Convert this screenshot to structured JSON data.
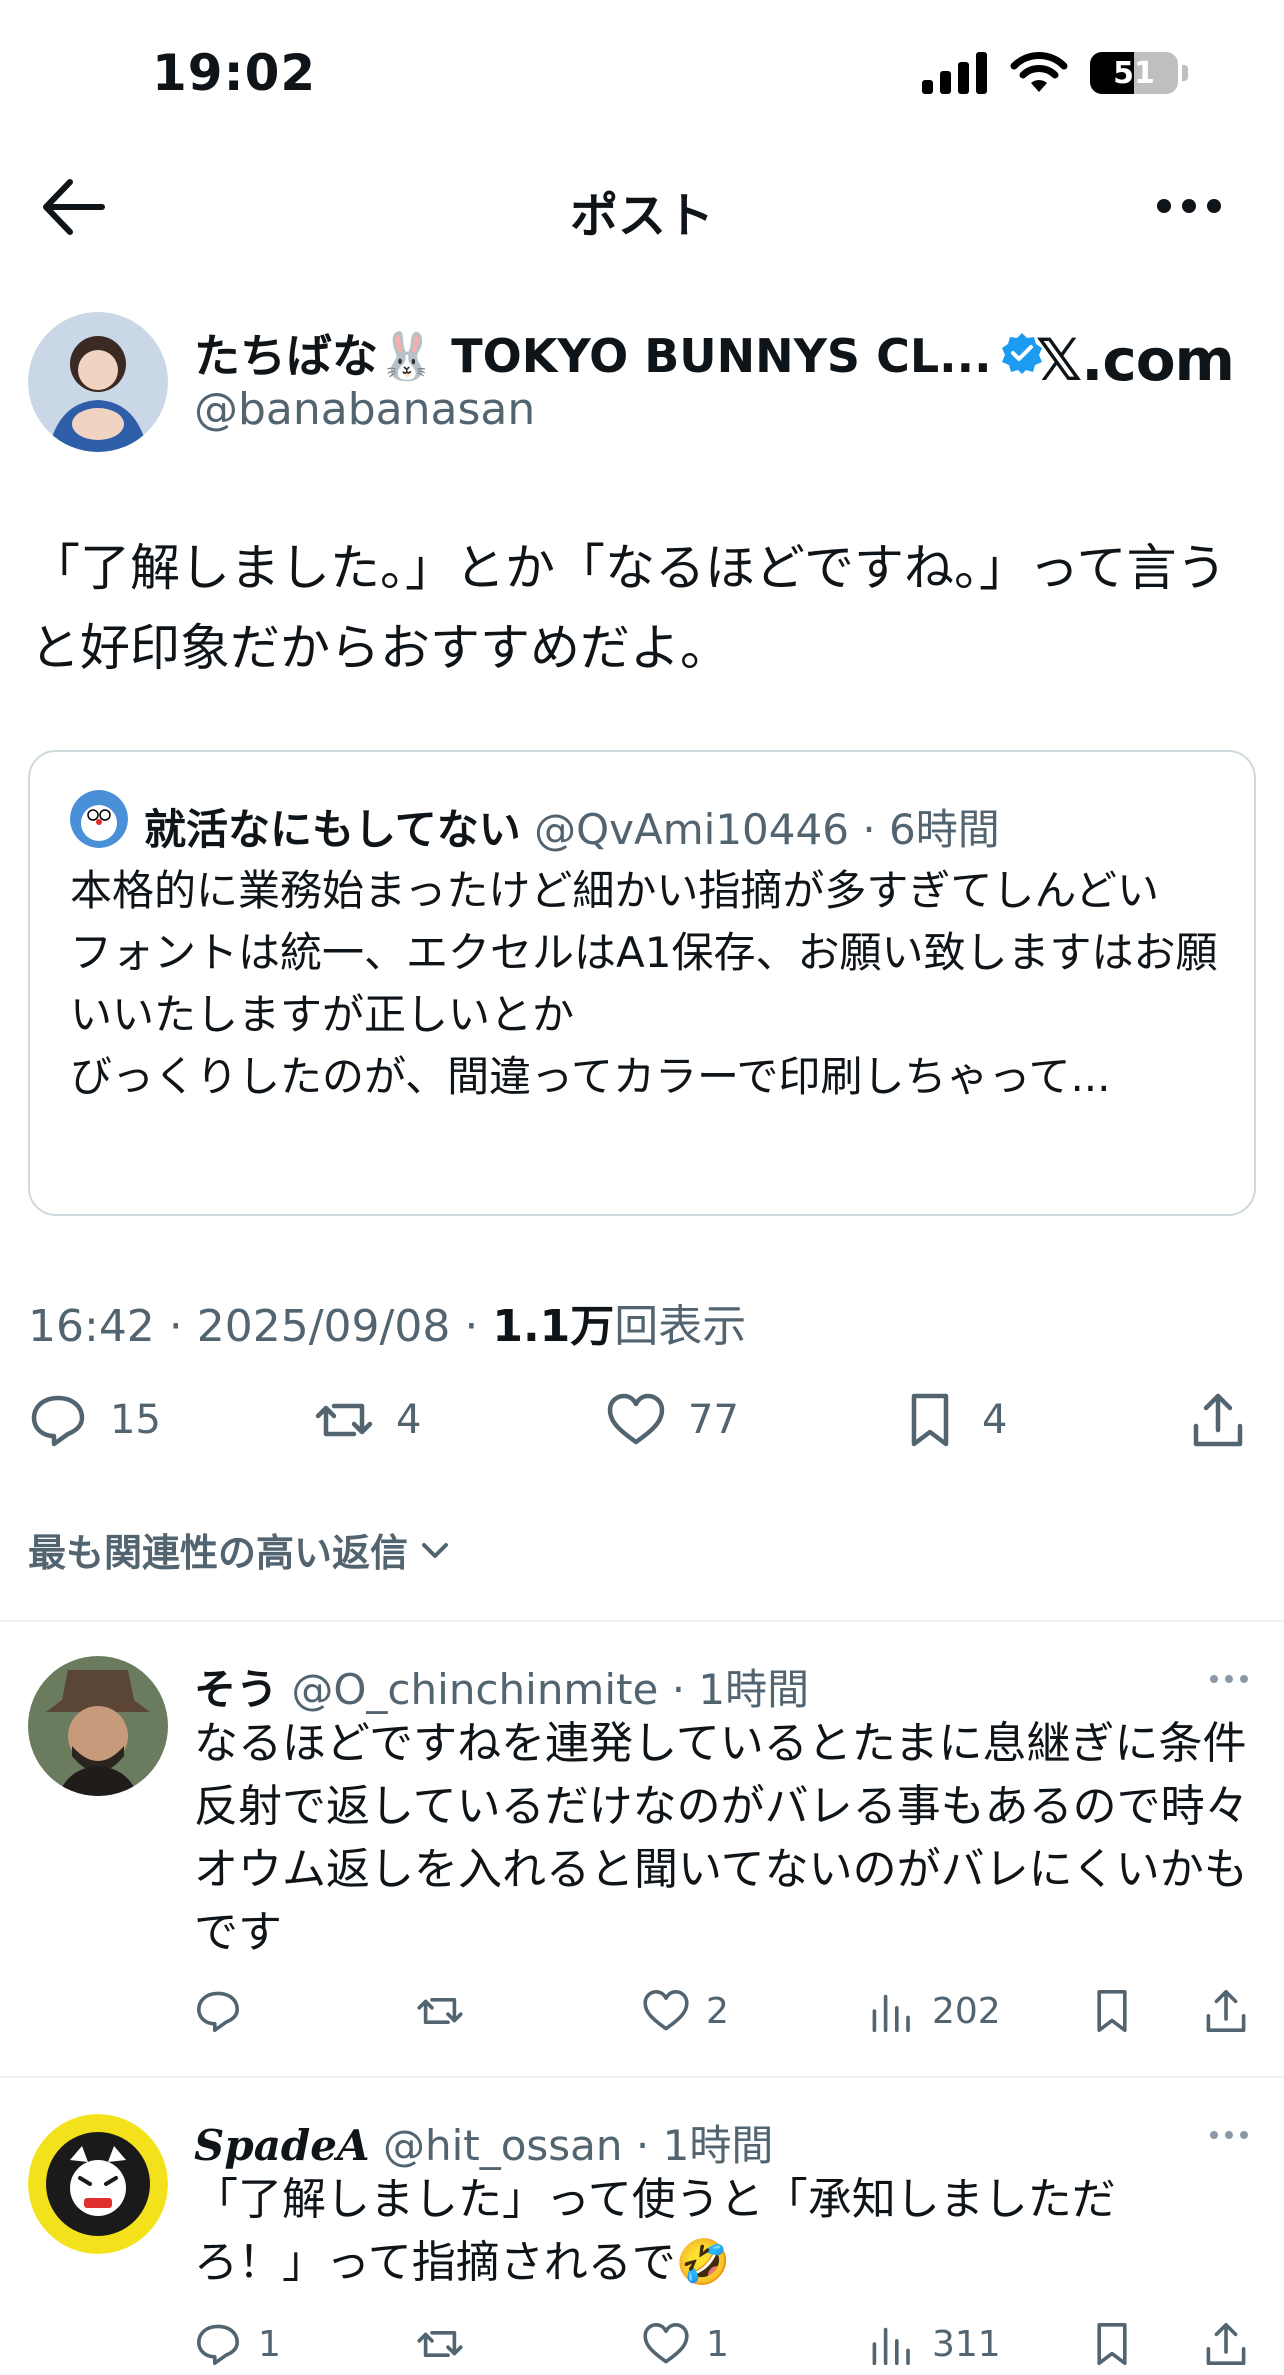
{
  "status_bar": {
    "time": "19:02",
    "battery": "51"
  },
  "nav": {
    "title": "ポスト"
  },
  "post": {
    "author_name": "たちばな🐰 TOKYO BUNNYS CL...",
    "author_handle": "@banabanasan",
    "watermark": "𝕏.com",
    "text": "「了解しました。」とか「なるほどですね。」って言うと好印象だからおすすめだよ。",
    "quote": {
      "name": "就活なにもしてない",
      "handle": "@QvAmi10446",
      "time": "· 6時間",
      "text": "本格的に業務始まったけど細かい指摘が多すぎてしんどい\nフォントは統一、エクセルはA1保存、お願い致しますはお願いいたしますが正しいとか\nびっくりしたのが、間違ってカラーで印刷しちゃって..."
    },
    "timestamp": "16:42 · 2025/09/08 · ",
    "views_count": "1.1万",
    "views_label": "回表示",
    "replies": "15",
    "reposts": "4",
    "likes": "77",
    "bookmarks": "4"
  },
  "sort_label": "最も関連性の高い返信",
  "replies": [
    {
      "name": "そう",
      "handle": "@O_chinchinmite",
      "time": "· 1時間",
      "text": "なるほどですねを連発しているとたまに息継ぎに条件反射で返しているだけなのがバレる事もあるので時々オウム返しを入れると聞いてないのがバレにくいかもです",
      "replies": "",
      "reposts": "",
      "likes": "2",
      "views": "202"
    },
    {
      "name": "SpadeA",
      "handle": "@hit_ossan",
      "time": "· 1時間",
      "text": "「了解しました」って使うと「承知しましただろ！」って指摘されるで🤣",
      "replies": "1",
      "reposts": "",
      "likes": "1",
      "views": "311"
    }
  ],
  "colors": {
    "verified": "#1d9bf0",
    "secondary_text": "#536471",
    "divider": "#eff3f4"
  }
}
